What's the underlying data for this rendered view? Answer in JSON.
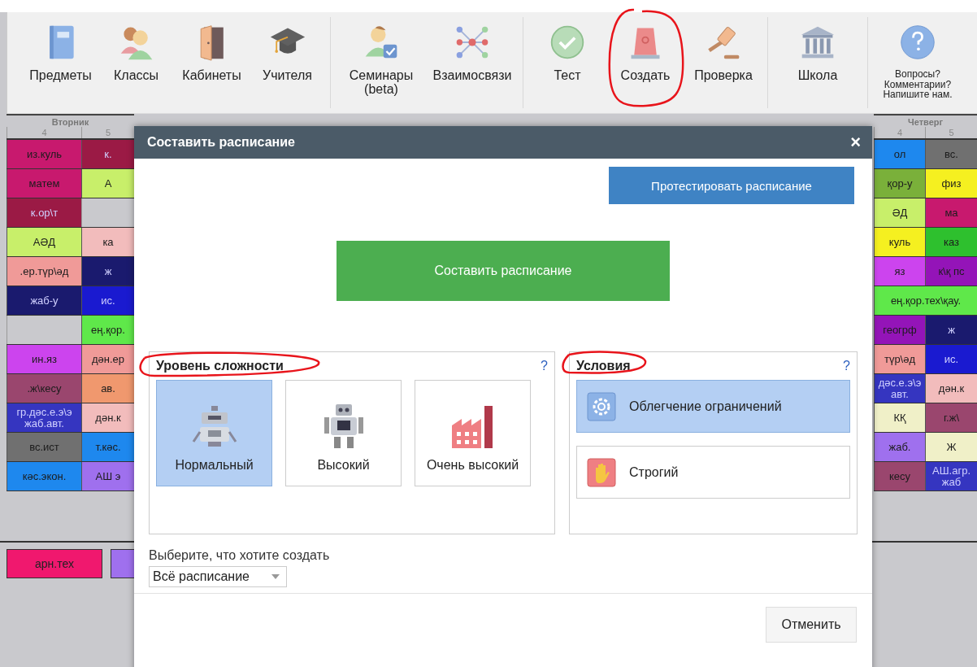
{
  "toolbar": {
    "groups": [
      [
        {
          "label": "Предметы",
          "kind": "book"
        },
        {
          "label": "Классы",
          "kind": "people"
        },
        {
          "label": "Кабинеты",
          "kind": "door"
        },
        {
          "label": "Учителя",
          "kind": "cap"
        }
      ],
      [
        {
          "label": "Семинары\n(beta)",
          "kind": "personcheck"
        },
        {
          "label": "Взаимосвязи",
          "kind": "network"
        }
      ],
      [
        {
          "label": "Тест",
          "kind": "badge"
        },
        {
          "label": "Создать",
          "kind": "siren"
        },
        {
          "label": "Проверка",
          "kind": "gavel"
        }
      ],
      [
        {
          "label": "Школа",
          "kind": "building"
        }
      ],
      [
        {
          "label": "Вопросы?\nКомментарии?\nНапишите нам.",
          "kind": "question"
        }
      ]
    ]
  },
  "timetable": {
    "left": {
      "day": "Вторник",
      "columns": [
        "4",
        "5"
      ],
      "rows": [
        [
          {
            "text": "из.куль",
            "color": "#c8196e"
          },
          {
            "text": "к.",
            "color": "#9b1a45"
          }
        ],
        [
          {
            "text": "матем",
            "color": "#c8196e"
          },
          {
            "text": "А",
            "color": "#c8ef6a"
          }
        ],
        [
          {
            "text": "к.ор\\т",
            "color": "#9b1a45"
          },
          {}
        ],
        [
          {
            "text": "АӘД",
            "color": "#c8ef6a"
          },
          {
            "text": "ка",
            "color": "#f2bcbc"
          }
        ],
        [
          {
            "text": ".ер.түр\\әд",
            "color": "#f09a98"
          },
          {
            "text": "ж",
            "color": "#1a1a6e"
          }
        ],
        [
          {
            "text": "жаб-у",
            "color": "#1a1a6e"
          },
          {
            "text": "ис.",
            "color": "#1a1ad0"
          }
        ],
        [
          {},
          {
            "text": "ең.қор.",
            "color": "#5fe84a"
          }
        ],
        [
          {
            "text": "ин.яз",
            "color": "#cc44ee"
          },
          {
            "text": "дән.ер",
            "color": "#f09a98"
          }
        ],
        [
          {
            "text": ".ж\\кесу",
            "color": "#9a466e"
          },
          {
            "text": "ав.",
            "color": "#f0986e"
          }
        ],
        [
          {
            "text": "гр.дәс.е.э\\э жаб.авт.",
            "color": "#3535c0"
          },
          {
            "text": "дән.к",
            "color": "#f2bcbc"
          }
        ],
        [
          {
            "text": "вс.ист",
            "color": "#707070"
          },
          {
            "text": "т.кәс.",
            "color": "#1e88ee"
          }
        ],
        [
          {
            "text": "кәс.экон.",
            "color": "#1e88ee"
          },
          {
            "text": "АШ э",
            "color": "#9f70ee"
          }
        ]
      ]
    },
    "right": {
      "day": "Четверг",
      "columns": [
        "4",
        "5"
      ],
      "rows": [
        [
          {
            "text": "ол",
            "color": "#1e88ee"
          },
          {
            "text": "вс.",
            "color": "#707070"
          }
        ],
        [
          {
            "text": "қор-у",
            "color": "#7ab03a"
          },
          {
            "text": "физ",
            "color": "#f5f020"
          }
        ],
        [
          {
            "text": "ӘД",
            "color": "#c8ef6a"
          },
          {
            "text": "ма",
            "color": "#c8196e"
          }
        ],
        [
          {
            "text": "куль",
            "color": "#f5f020"
          },
          {
            "text": "каз",
            "color": "#2ec02e"
          }
        ],
        [
          {
            "text": "яз",
            "color": "#cc44ee"
          },
          {
            "text": "к\\қ пс",
            "color": "#9414b8"
          }
        ],
        [
          {
            "text": "ең.қор.тех\\қау.",
            "color": "#5fe84a"
          }
        ],
        [
          {
            "text": "геогрф",
            "color": "#9414b8"
          },
          {
            "text": "ж",
            "color": "#1a1a6e"
          }
        ],
        [
          {
            "text": "түр\\әд",
            "color": "#f09a98"
          },
          {
            "text": "ис.",
            "color": "#1a1ad0"
          }
        ],
        [
          {
            "text": "дәс.е.э\\э авт.",
            "color": "#3535c0"
          },
          {
            "text": "дән.к",
            "color": "#f2bcbc"
          }
        ],
        [
          {
            "text": "КҚ",
            "color": "#f0f0c8"
          },
          {
            "text": "г.ж\\",
            "color": "#9a466e"
          }
        ],
        [
          {
            "text": "жаб.",
            "color": "#9f70ee"
          },
          {
            "text": "Ж",
            "color": "#f0f0c8"
          }
        ],
        [
          {
            "text": "кесу",
            "color": "#9a466e"
          },
          {
            "text": "АШ.агр. жаб",
            "color": "#3535c0"
          }
        ]
      ]
    },
    "unplaced": [
      {
        "text": "арн.тех",
        "color": "#f0186e"
      },
      {
        "color": "#9f70ee"
      }
    ]
  },
  "dialog": {
    "title": "Составить расписание",
    "close": "×",
    "test_button": "Протестировать расписание",
    "generate_button": "Составить расписание",
    "difficulty": {
      "title": "Уровень сложности",
      "help": "?",
      "options": [
        {
          "label": "Нормальный",
          "kind": "robot",
          "selected": true
        },
        {
          "label": "Высокий",
          "kind": "bigrobot",
          "selected": false
        },
        {
          "label": "Очень высокий",
          "kind": "factory",
          "selected": false
        }
      ]
    },
    "conditions": {
      "title": "Условия",
      "help": "?",
      "options": [
        {
          "label": "Облегчение ограничений",
          "kind": "gear",
          "selected": true
        },
        {
          "label": "Строгий",
          "kind": "hand",
          "selected": false
        }
      ]
    },
    "scope_label": "Выберите, что хотите создать",
    "scope_value": "Всё расписание",
    "cancel_button": "Отменить"
  }
}
